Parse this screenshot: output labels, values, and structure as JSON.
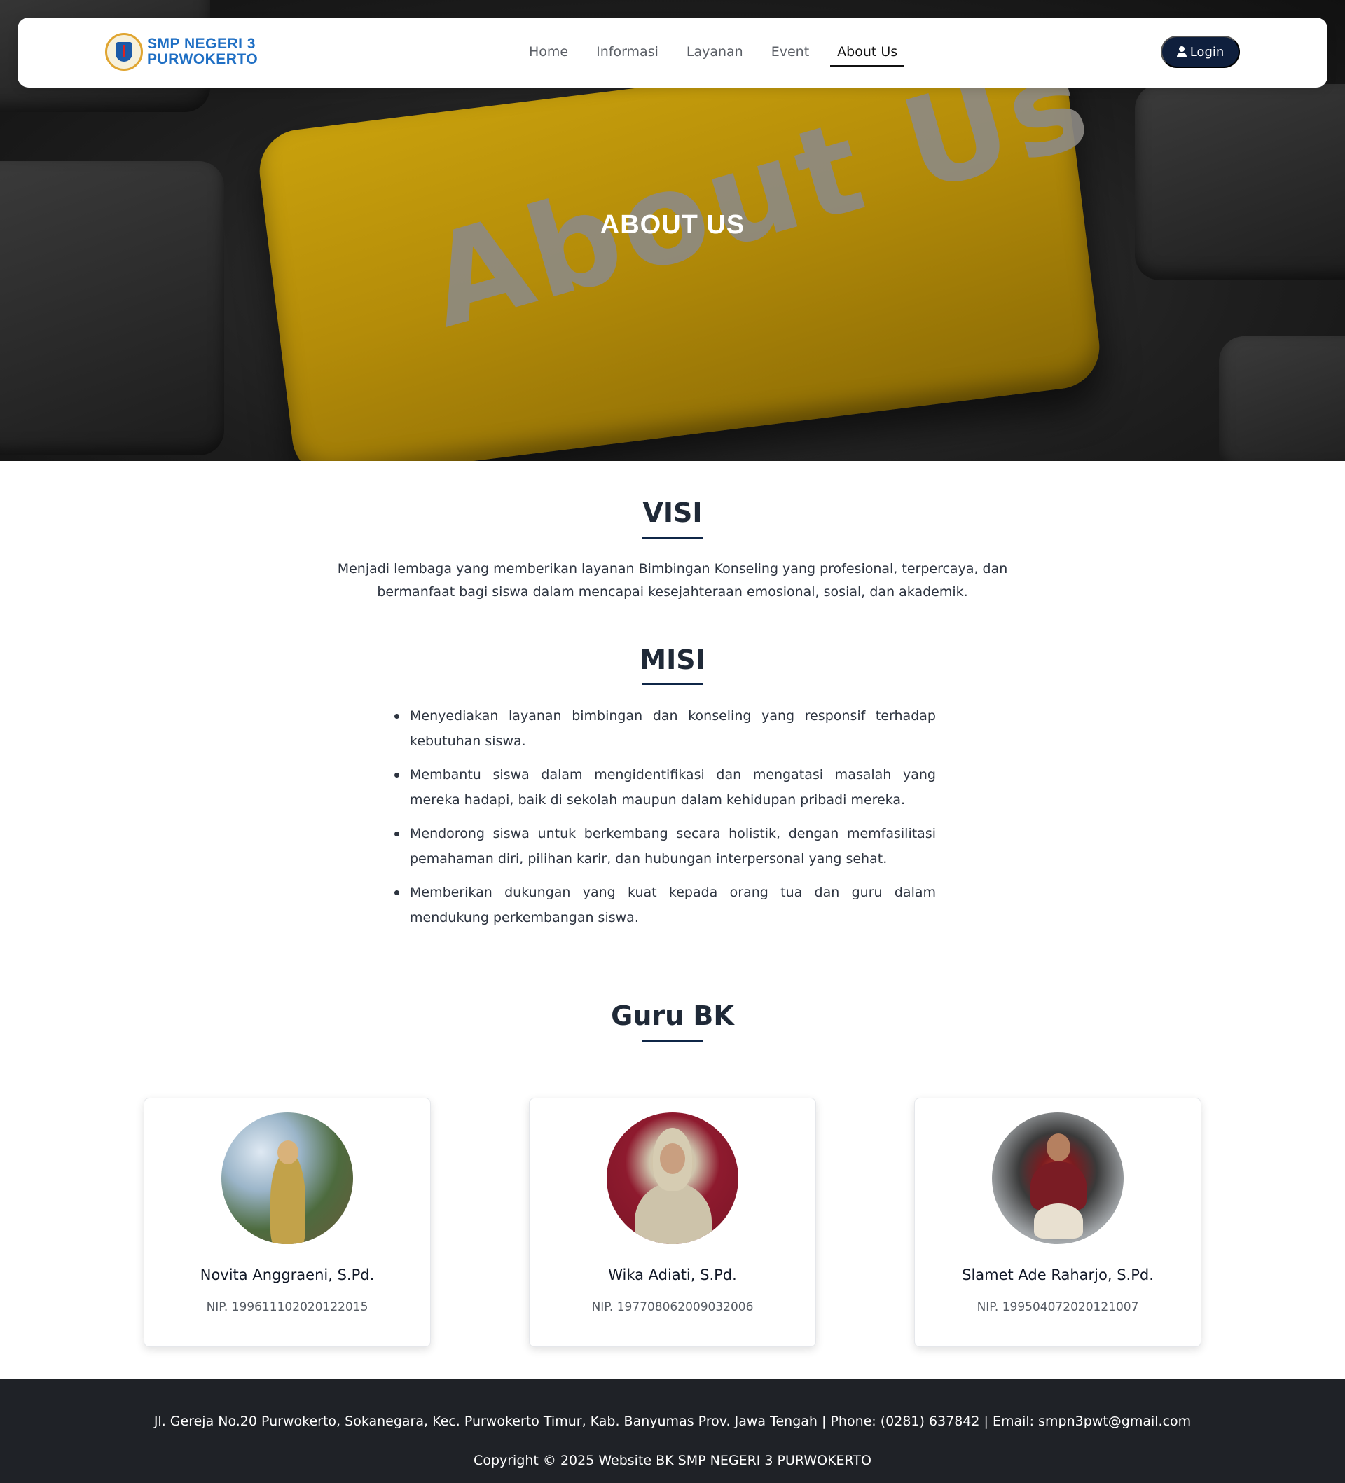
{
  "nav": {
    "logo_line1": "SMP NEGERI 3",
    "logo_line2": "PURWOKERTO",
    "links": [
      "Home",
      "Informasi",
      "Layanan",
      "Event",
      "About Us"
    ],
    "active": "About Us",
    "login_label": "Login"
  },
  "hero": {
    "title": "ABOUT US",
    "key_text": "About Us"
  },
  "visi": {
    "title": "VISI",
    "text": "Menjadi lembaga yang memberikan layanan Bimbingan Konseling yang profesional, terpercaya, dan bermanfaat bagi siswa dalam mencapai kesejahteraan emosional, sosial, dan akademik."
  },
  "misi": {
    "title": "MISI",
    "items": [
      "Menyediakan layanan bimbingan dan konseling yang responsif terhadap kebutuhan siswa.",
      "Membantu siswa dalam mengidentifikasi dan mengatasi masalah yang mereka hadapi, baik di sekolah maupun dalam kehidupan pribadi mereka.",
      "Mendorong siswa untuk berkembang secara holistik, dengan memfasilitasi pemahaman diri, pilihan karir, dan hubungan interpersonal yang sehat.",
      "Memberikan dukungan yang kuat kepada orang tua dan guru dalam mendukung perkembangan siswa."
    ]
  },
  "guru": {
    "title": "Guru BK",
    "members": [
      {
        "name": "Novita Anggraeni, S.Pd.",
        "nip": "NIP. 199611102020122015"
      },
      {
        "name": "Wika Adiati, S.Pd.",
        "nip": "NIP. 197708062009032006"
      },
      {
        "name": "Slamet Ade Raharjo, S.Pd.",
        "nip": "NIP. 199504072020121007"
      }
    ]
  },
  "footer": {
    "address": "Jl. Gereja No.20 Purwokerto, Sokanegara, Kec. Purwokerto Timur, Kab. Banyumas Prov. Jawa Tengah | Phone: (0281) 637842 | Email: smpn3pwt@gmail.com",
    "copyright": "Copyright © 2025 Website BK SMP NEGERI 3 PURWOKERTO"
  },
  "colors": {
    "navy": "#0f1f3d",
    "footer_bg": "#1f2227",
    "key_yellow": "#b48c09"
  }
}
